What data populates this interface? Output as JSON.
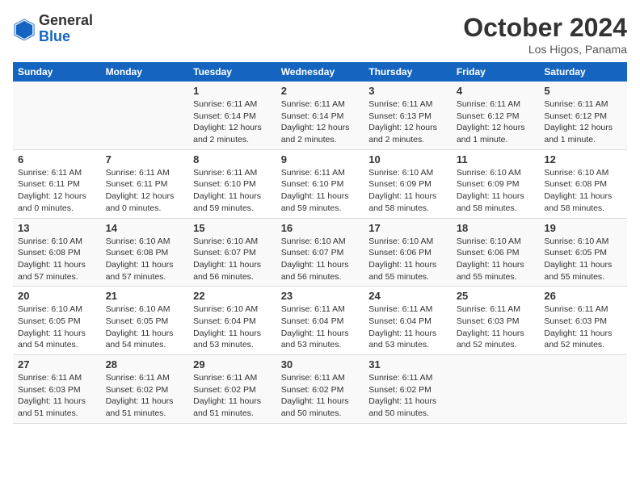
{
  "header": {
    "logo_general": "General",
    "logo_blue": "Blue",
    "month_title": "October 2024",
    "location": "Los Higos, Panama"
  },
  "weekdays": [
    "Sunday",
    "Monday",
    "Tuesday",
    "Wednesday",
    "Thursday",
    "Friday",
    "Saturday"
  ],
  "weeks": [
    [
      {
        "day": "",
        "info": ""
      },
      {
        "day": "",
        "info": ""
      },
      {
        "day": "1",
        "info": "Sunrise: 6:11 AM\nSunset: 6:14 PM\nDaylight: 12 hours and 2 minutes."
      },
      {
        "day": "2",
        "info": "Sunrise: 6:11 AM\nSunset: 6:14 PM\nDaylight: 12 hours and 2 minutes."
      },
      {
        "day": "3",
        "info": "Sunrise: 6:11 AM\nSunset: 6:13 PM\nDaylight: 12 hours and 2 minutes."
      },
      {
        "day": "4",
        "info": "Sunrise: 6:11 AM\nSunset: 6:12 PM\nDaylight: 12 hours and 1 minute."
      },
      {
        "day": "5",
        "info": "Sunrise: 6:11 AM\nSunset: 6:12 PM\nDaylight: 12 hours and 1 minute."
      }
    ],
    [
      {
        "day": "6",
        "info": "Sunrise: 6:11 AM\nSunset: 6:11 PM\nDaylight: 12 hours and 0 minutes."
      },
      {
        "day": "7",
        "info": "Sunrise: 6:11 AM\nSunset: 6:11 PM\nDaylight: 12 hours and 0 minutes."
      },
      {
        "day": "8",
        "info": "Sunrise: 6:11 AM\nSunset: 6:10 PM\nDaylight: 11 hours and 59 minutes."
      },
      {
        "day": "9",
        "info": "Sunrise: 6:11 AM\nSunset: 6:10 PM\nDaylight: 11 hours and 59 minutes."
      },
      {
        "day": "10",
        "info": "Sunrise: 6:10 AM\nSunset: 6:09 PM\nDaylight: 11 hours and 58 minutes."
      },
      {
        "day": "11",
        "info": "Sunrise: 6:10 AM\nSunset: 6:09 PM\nDaylight: 11 hours and 58 minutes."
      },
      {
        "day": "12",
        "info": "Sunrise: 6:10 AM\nSunset: 6:08 PM\nDaylight: 11 hours and 58 minutes."
      }
    ],
    [
      {
        "day": "13",
        "info": "Sunrise: 6:10 AM\nSunset: 6:08 PM\nDaylight: 11 hours and 57 minutes."
      },
      {
        "day": "14",
        "info": "Sunrise: 6:10 AM\nSunset: 6:08 PM\nDaylight: 11 hours and 57 minutes."
      },
      {
        "day": "15",
        "info": "Sunrise: 6:10 AM\nSunset: 6:07 PM\nDaylight: 11 hours and 56 minutes."
      },
      {
        "day": "16",
        "info": "Sunrise: 6:10 AM\nSunset: 6:07 PM\nDaylight: 11 hours and 56 minutes."
      },
      {
        "day": "17",
        "info": "Sunrise: 6:10 AM\nSunset: 6:06 PM\nDaylight: 11 hours and 55 minutes."
      },
      {
        "day": "18",
        "info": "Sunrise: 6:10 AM\nSunset: 6:06 PM\nDaylight: 11 hours and 55 minutes."
      },
      {
        "day": "19",
        "info": "Sunrise: 6:10 AM\nSunset: 6:05 PM\nDaylight: 11 hours and 55 minutes."
      }
    ],
    [
      {
        "day": "20",
        "info": "Sunrise: 6:10 AM\nSunset: 6:05 PM\nDaylight: 11 hours and 54 minutes."
      },
      {
        "day": "21",
        "info": "Sunrise: 6:10 AM\nSunset: 6:05 PM\nDaylight: 11 hours and 54 minutes."
      },
      {
        "day": "22",
        "info": "Sunrise: 6:10 AM\nSunset: 6:04 PM\nDaylight: 11 hours and 53 minutes."
      },
      {
        "day": "23",
        "info": "Sunrise: 6:11 AM\nSunset: 6:04 PM\nDaylight: 11 hours and 53 minutes."
      },
      {
        "day": "24",
        "info": "Sunrise: 6:11 AM\nSunset: 6:04 PM\nDaylight: 11 hours and 53 minutes."
      },
      {
        "day": "25",
        "info": "Sunrise: 6:11 AM\nSunset: 6:03 PM\nDaylight: 11 hours and 52 minutes."
      },
      {
        "day": "26",
        "info": "Sunrise: 6:11 AM\nSunset: 6:03 PM\nDaylight: 11 hours and 52 minutes."
      }
    ],
    [
      {
        "day": "27",
        "info": "Sunrise: 6:11 AM\nSunset: 6:03 PM\nDaylight: 11 hours and 51 minutes."
      },
      {
        "day": "28",
        "info": "Sunrise: 6:11 AM\nSunset: 6:02 PM\nDaylight: 11 hours and 51 minutes."
      },
      {
        "day": "29",
        "info": "Sunrise: 6:11 AM\nSunset: 6:02 PM\nDaylight: 11 hours and 51 minutes."
      },
      {
        "day": "30",
        "info": "Sunrise: 6:11 AM\nSunset: 6:02 PM\nDaylight: 11 hours and 50 minutes."
      },
      {
        "day": "31",
        "info": "Sunrise: 6:11 AM\nSunset: 6:02 PM\nDaylight: 11 hours and 50 minutes."
      },
      {
        "day": "",
        "info": ""
      },
      {
        "day": "",
        "info": ""
      }
    ]
  ]
}
